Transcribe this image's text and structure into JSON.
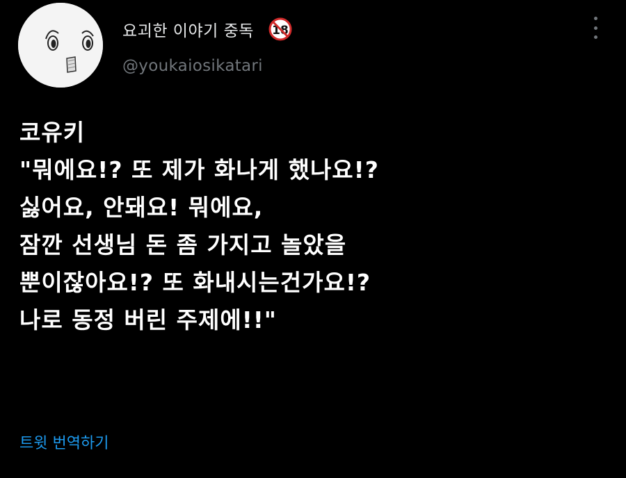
{
  "user": {
    "display_name": "요괴한 이야기 중독",
    "badge_text": "18",
    "handle": "@youkaiosikatari"
  },
  "tweet": {
    "lines": [
      "코유키",
      "\"뭐에요!? 또 제가 화나게 했나요!?",
      "싫어요, 안돼요! 뭐에요,",
      "잠깐 선생님 돈 좀 가지고 놀았을",
      "뿐이잖아요!? 또 화내시는건가요!?",
      "나로 동정 버린 주제에!!\""
    ]
  },
  "translate_label": "트윗 번역하기",
  "colors": {
    "background": "#000000",
    "text": "#ffffff",
    "muted": "#71767b",
    "link": "#1d9bf0",
    "badge_red": "#d12a2a"
  },
  "icons": {
    "avatar": "cartoon-face-avatar",
    "badge": "no-under-18-icon",
    "more": "more-vertical-icon"
  }
}
